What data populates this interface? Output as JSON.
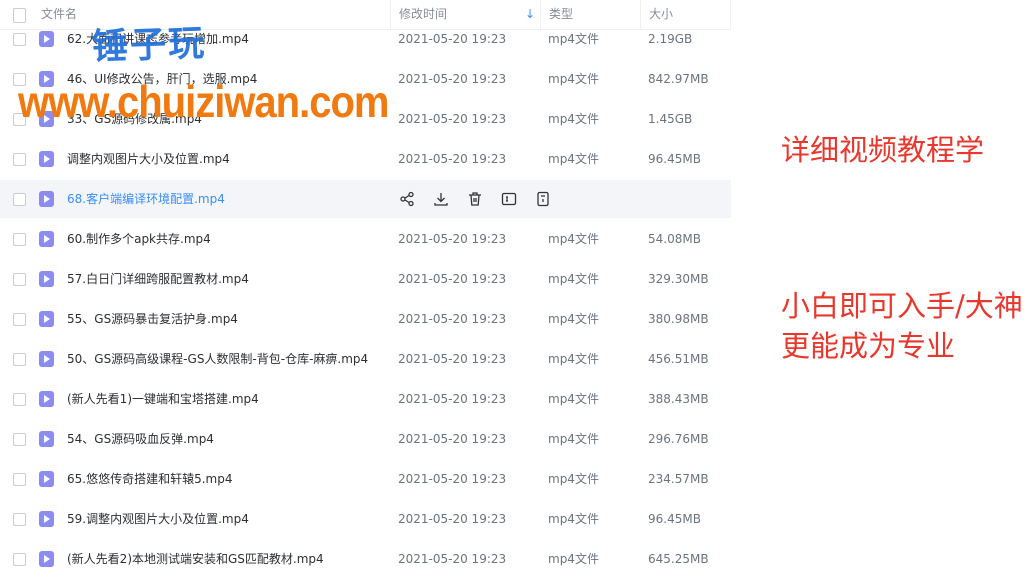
{
  "header": {
    "name": "文件名",
    "time": "修改时间",
    "type": "类型",
    "size": "大小"
  },
  "rows": [
    {
      "name": "62.大面积讲课志参考玩增加.mp4",
      "time": "2021-05-20 19:23",
      "type": "mp4文件",
      "size": "2.19GB"
    },
    {
      "name": "46、UI修改公告，肝门，选服.mp4",
      "time": "2021-05-20 19:23",
      "type": "mp4文件",
      "size": "842.97MB"
    },
    {
      "name": "33、GS源码修改属.mp4",
      "time": "2021-05-20 19:23",
      "type": "mp4文件",
      "size": "1.45GB"
    },
    {
      "name": "调整内观图片大小及位置.mp4",
      "time": "2021-05-20 19:23",
      "type": "mp4文件",
      "size": "96.45MB"
    },
    {
      "name": "68.客户端编译环境配置.mp4",
      "time": "",
      "type": "",
      "size": ""
    },
    {
      "name": "60.制作多个apk共存.mp4",
      "time": "2021-05-20 19:23",
      "type": "mp4文件",
      "size": "54.08MB"
    },
    {
      "name": "57.白日门详细跨服配置教材.mp4",
      "time": "2021-05-20 19:23",
      "type": "mp4文件",
      "size": "329.30MB"
    },
    {
      "name": "55、GS源码暴击复活护身.mp4",
      "time": "2021-05-20 19:23",
      "type": "mp4文件",
      "size": "380.98MB"
    },
    {
      "name": "50、GS源码高级课程-GS人数限制-背包-仓库-麻痹.mp4",
      "time": "2021-05-20 19:23",
      "type": "mp4文件",
      "size": "456.51MB"
    },
    {
      "name": "(新人先看1)一键端和宝塔搭建.mp4",
      "time": "2021-05-20 19:23",
      "type": "mp4文件",
      "size": "388.43MB"
    },
    {
      "name": "54、GS源码吸血反弹.mp4",
      "time": "2021-05-20 19:23",
      "type": "mp4文件",
      "size": "296.76MB"
    },
    {
      "name": "65.悠悠传奇搭建和轩辕5.mp4",
      "time": "2021-05-20 19:23",
      "type": "mp4文件",
      "size": "234.57MB"
    },
    {
      "name": "59.调整内观图片大小及位置.mp4",
      "time": "2021-05-20 19:23",
      "type": "mp4文件",
      "size": "96.45MB"
    },
    {
      "name": "(新人先看2)本地测试端安装和GS匹配教材.mp4",
      "time": "2021-05-20 19:23",
      "type": "mp4文件",
      "size": "645.25MB"
    }
  ],
  "hover_row_index": 4,
  "actions": [
    "share-icon",
    "download-icon",
    "delete-icon",
    "rename-icon",
    "more-icon"
  ],
  "watermark": {
    "logo_cn": "锤子玩",
    "logo_url": "www.chuiziwan.com"
  },
  "promo": {
    "line1": "详细视频教程学",
    "line2": "小白即可入手/大神",
    "line3": "更能成为专业"
  },
  "colors": {
    "accent": "#3a8ef6",
    "file_icon": "#8a8cf2",
    "promo": "#e8382e",
    "watermark_blue": "#1f6fd8",
    "watermark_orange": "#f07a10"
  }
}
